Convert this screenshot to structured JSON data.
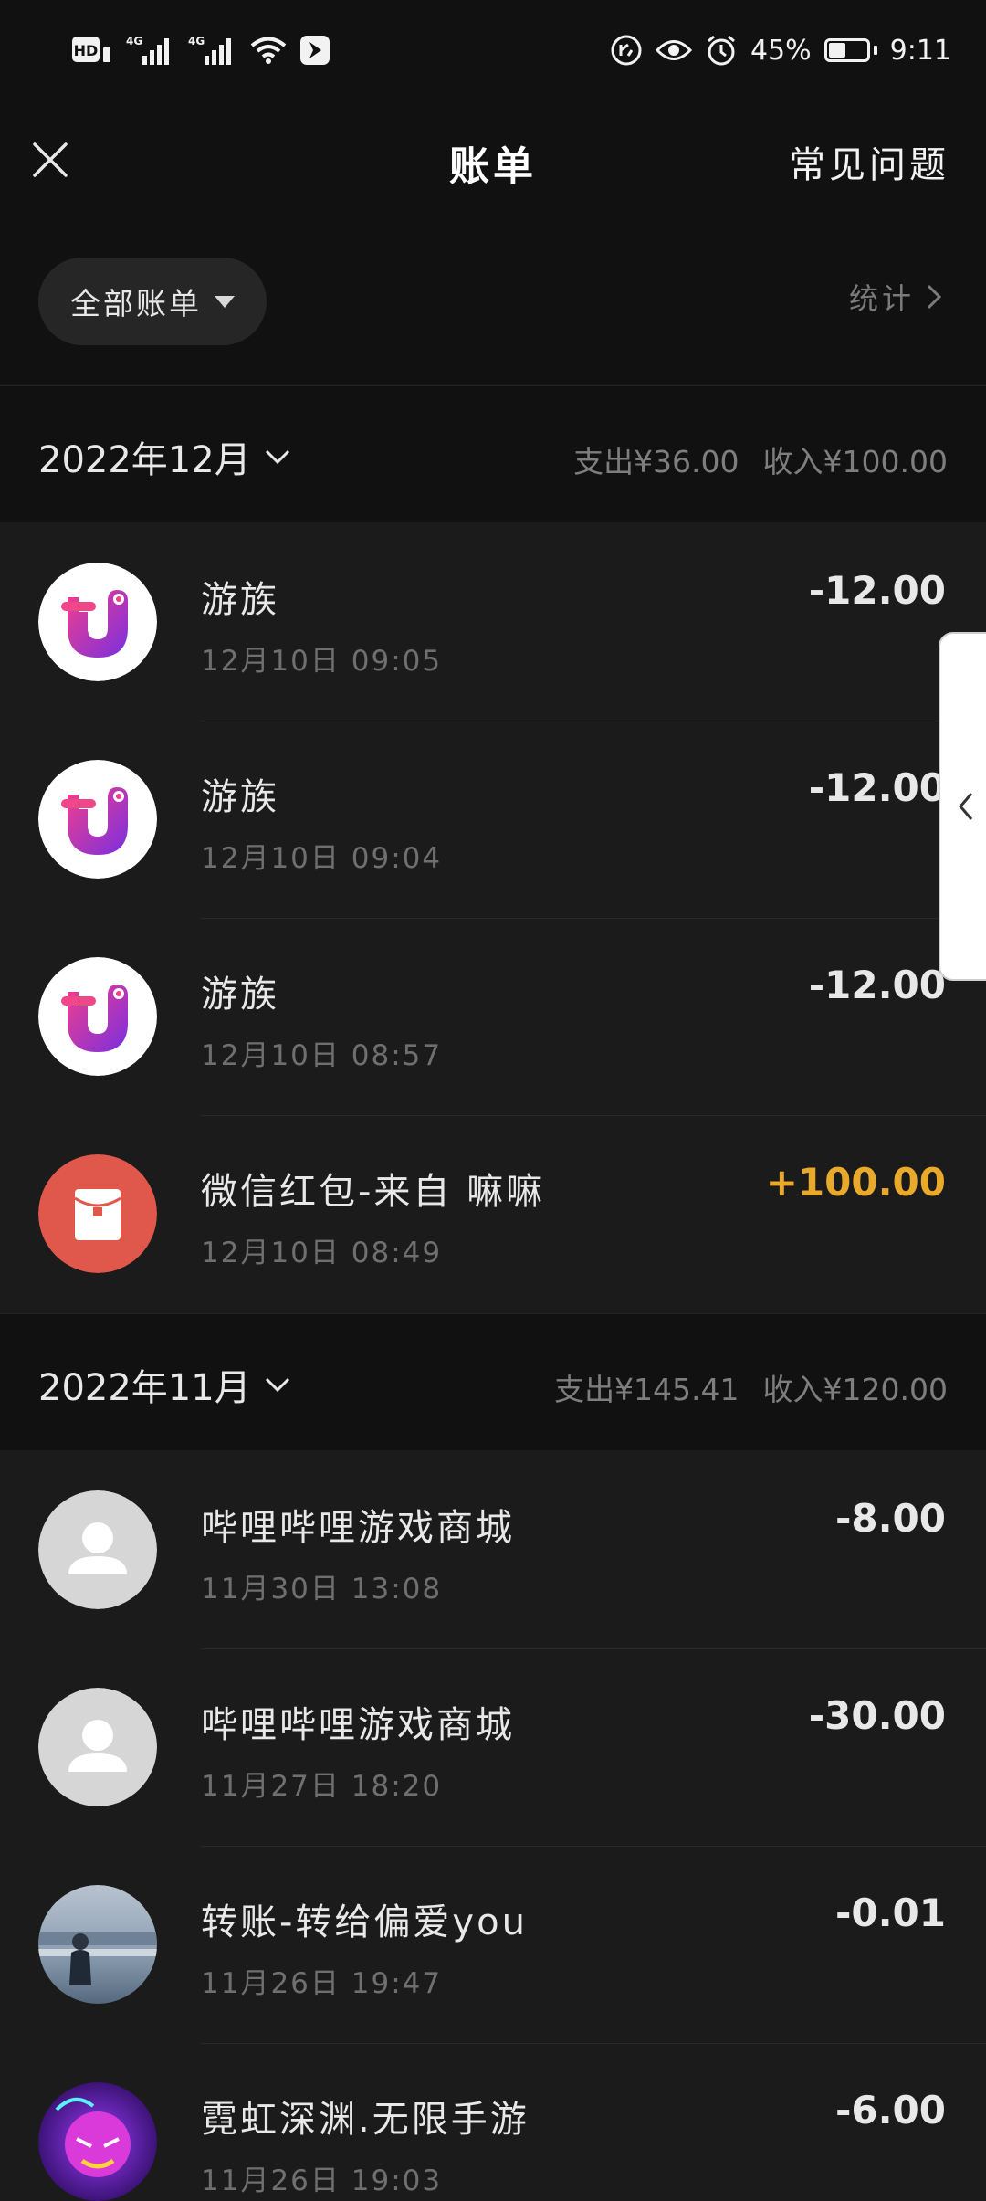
{
  "status_bar": {
    "hd": "HD",
    "net1": "4G",
    "net2": "4G",
    "battery_percent": "45%",
    "battery_level": 0.45,
    "time": "9:11"
  },
  "header": {
    "title": "账单",
    "faq": "常见问题"
  },
  "filter": {
    "label": "全部账单",
    "stats": "统计"
  },
  "months": [
    {
      "title": "2022年12月",
      "expense": "支出¥36.00",
      "income": "收入¥100.00",
      "transactions": [
        {
          "name": "游族",
          "time": "12月10日 09:05",
          "amount": "-12.00",
          "type": "expense",
          "icon": "youzu-logo-icon"
        },
        {
          "name": "游族",
          "time": "12月10日 09:04",
          "amount": "-12.00",
          "type": "expense",
          "icon": "youzu-logo-icon"
        },
        {
          "name": "游族",
          "time": "12月10日 08:57",
          "amount": "-12.00",
          "type": "expense",
          "icon": "youzu-logo-icon"
        },
        {
          "name": "微信红包-来自 嘛嘛",
          "time": "12月10日 08:49",
          "amount": "+100.00",
          "type": "income",
          "icon": "red-envelope-icon"
        }
      ]
    },
    {
      "title": "2022年11月",
      "expense": "支出¥145.41",
      "income": "收入¥120.00",
      "transactions": [
        {
          "name": "哔哩哔哩游戏商城",
          "time": "11月30日 13:08",
          "amount": "-8.00",
          "type": "expense",
          "icon": "default-user-icon"
        },
        {
          "name": "哔哩哔哩游戏商城",
          "time": "11月27日 18:20",
          "amount": "-30.00",
          "type": "expense",
          "icon": "default-user-icon"
        },
        {
          "name": "转账-转给偏爱you",
          "time": "11月26日 19:47",
          "amount": "-0.01",
          "type": "expense",
          "icon": "photo-avatar-icon"
        },
        {
          "name": "霓虹深渊.无限手游",
          "time": "11月26日 19:03",
          "amount": "-6.00",
          "type": "expense",
          "icon": "neon-abyss-avatar-icon"
        }
      ]
    }
  ],
  "colors": {
    "background": "#1b1b1b",
    "header_bg": "#111111",
    "income": "#e9a92a",
    "red_envelope": "#e0574b"
  }
}
